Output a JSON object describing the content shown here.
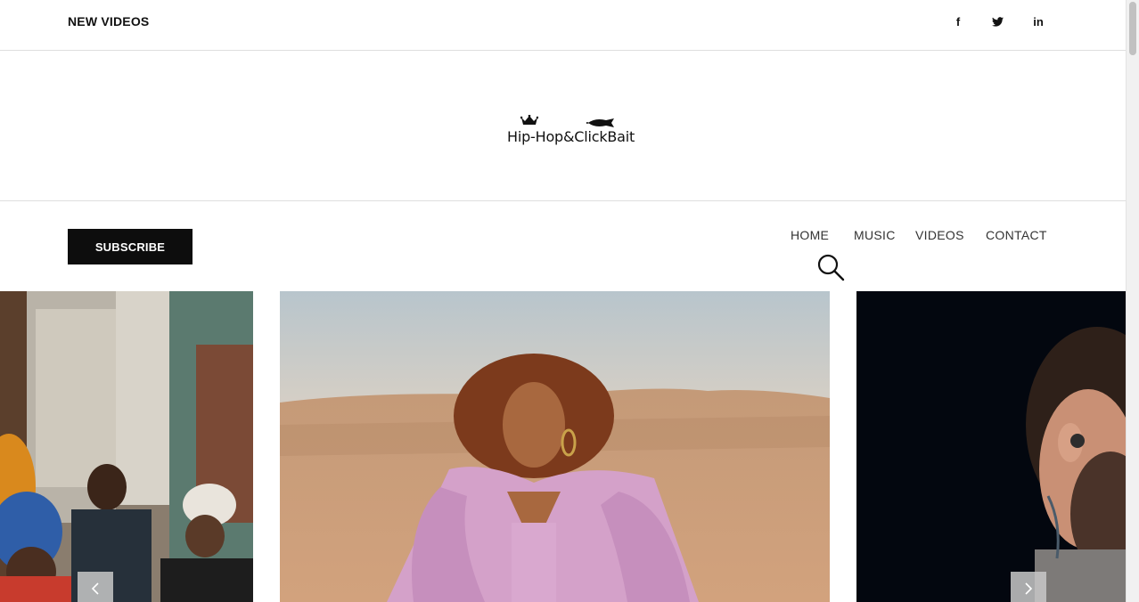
{
  "topbar": {
    "title": "NEW VIDEOS",
    "social": {
      "facebook": "f",
      "twitter": "twitter-bird-icon",
      "linkedin": "in"
    }
  },
  "logo": {
    "text": "Hip-Hop&ClickBait",
    "icons": [
      "crown-icon",
      "fish-icon"
    ]
  },
  "nav": {
    "subscribe_label": "SUBSCRIBE",
    "links": [
      {
        "label": "HOME"
      },
      {
        "label": "MUSIC"
      },
      {
        "label": "VIDEOS"
      },
      {
        "label": "CONTACT"
      }
    ],
    "search_icon": "search-icon"
  },
  "slider": {
    "slides": [
      {
        "description_icon": "group-photo"
      },
      {
        "description_icon": "desert-portrait"
      },
      {
        "description_icon": "concert-portrait"
      }
    ],
    "prev_icon": "chevron-left-icon",
    "next_icon": "chevron-right-icon"
  },
  "colors": {
    "accent": "#0d0d0d",
    "nav_text": "#333333",
    "divider": "#dedede",
    "arrow_bg": "#c8c8c8"
  }
}
